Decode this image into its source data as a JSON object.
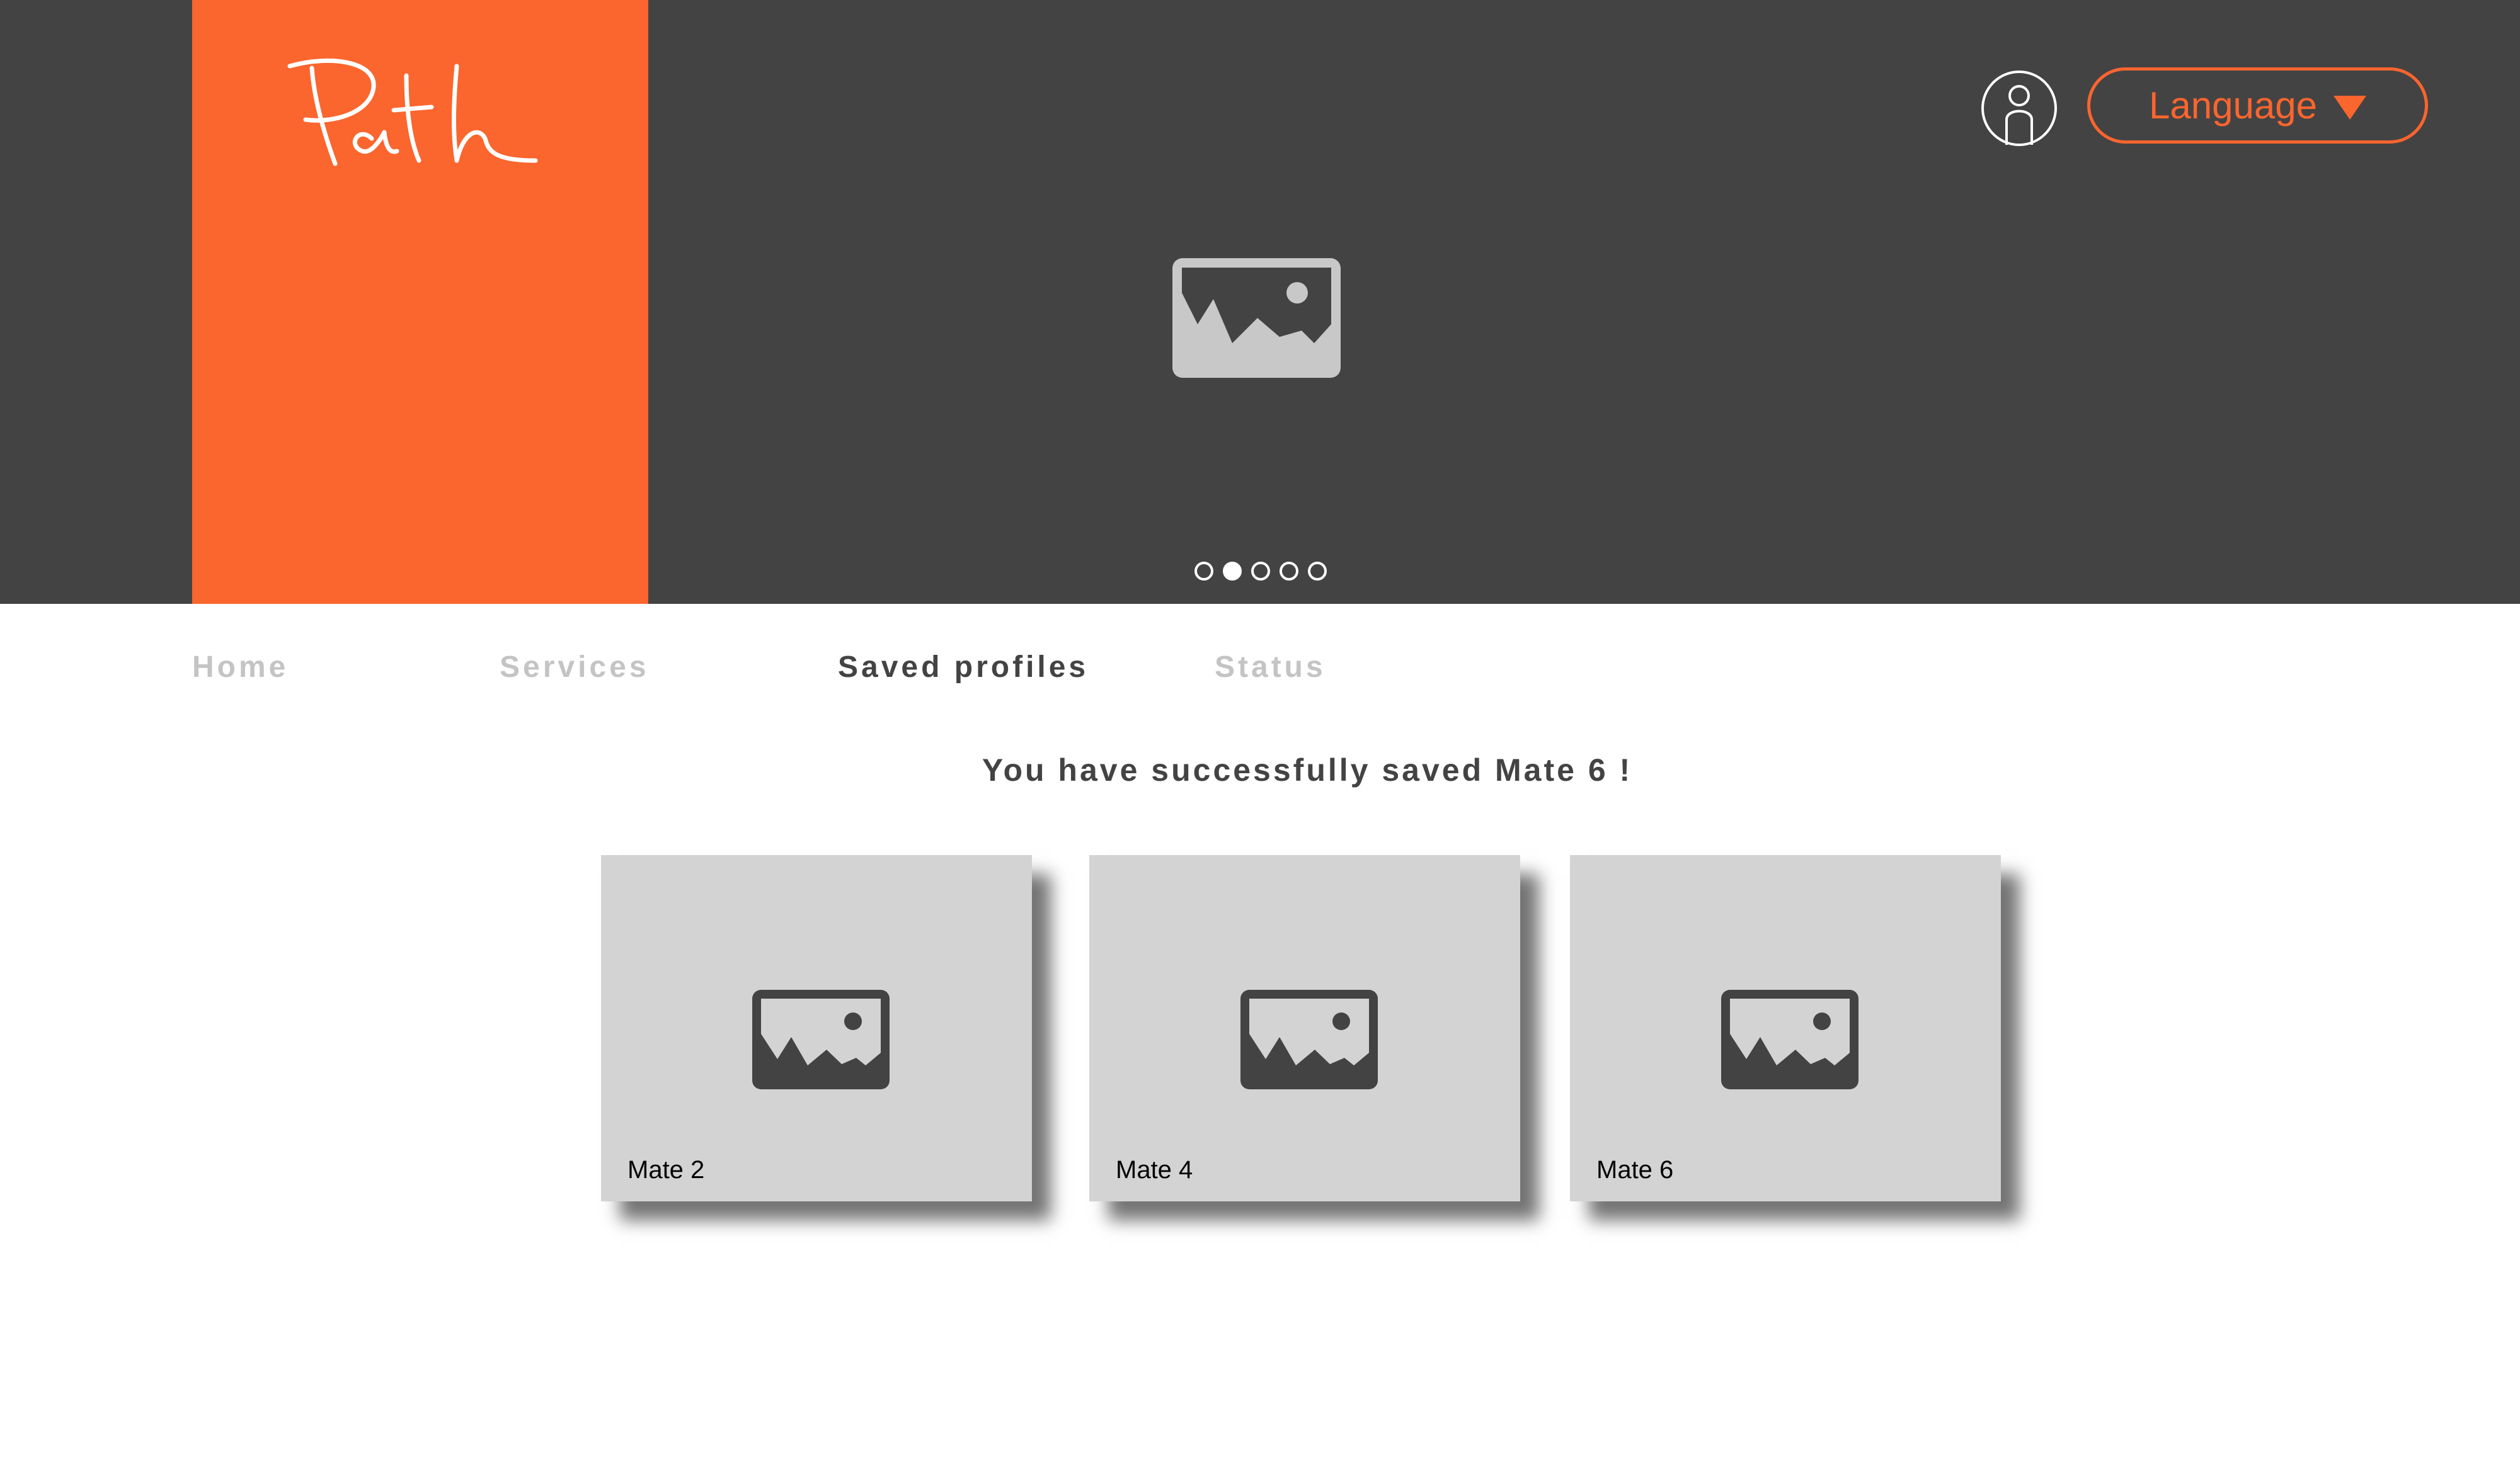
{
  "brand": {
    "logo_text": "Path",
    "accent_color": "#fb652e",
    "header_color": "#434343"
  },
  "header": {
    "user_icon": "user-icon",
    "language_label": "Language",
    "language_icon": "caret-down-icon"
  },
  "hero": {
    "image_icon": "image-placeholder-icon",
    "carousel_total": 5,
    "carousel_active_index": 1
  },
  "nav": {
    "items": [
      {
        "label": "Home",
        "active": false
      },
      {
        "label": "Services",
        "active": false
      },
      {
        "label": "Saved profiles",
        "active": true
      },
      {
        "label": "Status",
        "active": false
      }
    ]
  },
  "message": {
    "text": "You have successfully saved Mate 6 !"
  },
  "saved_profiles": [
    {
      "label": "Mate 2",
      "image_icon": "image-placeholder-icon"
    },
    {
      "label": "Mate 4",
      "image_icon": "image-placeholder-icon"
    },
    {
      "label": "Mate 6",
      "image_icon": "image-placeholder-icon"
    }
  ]
}
